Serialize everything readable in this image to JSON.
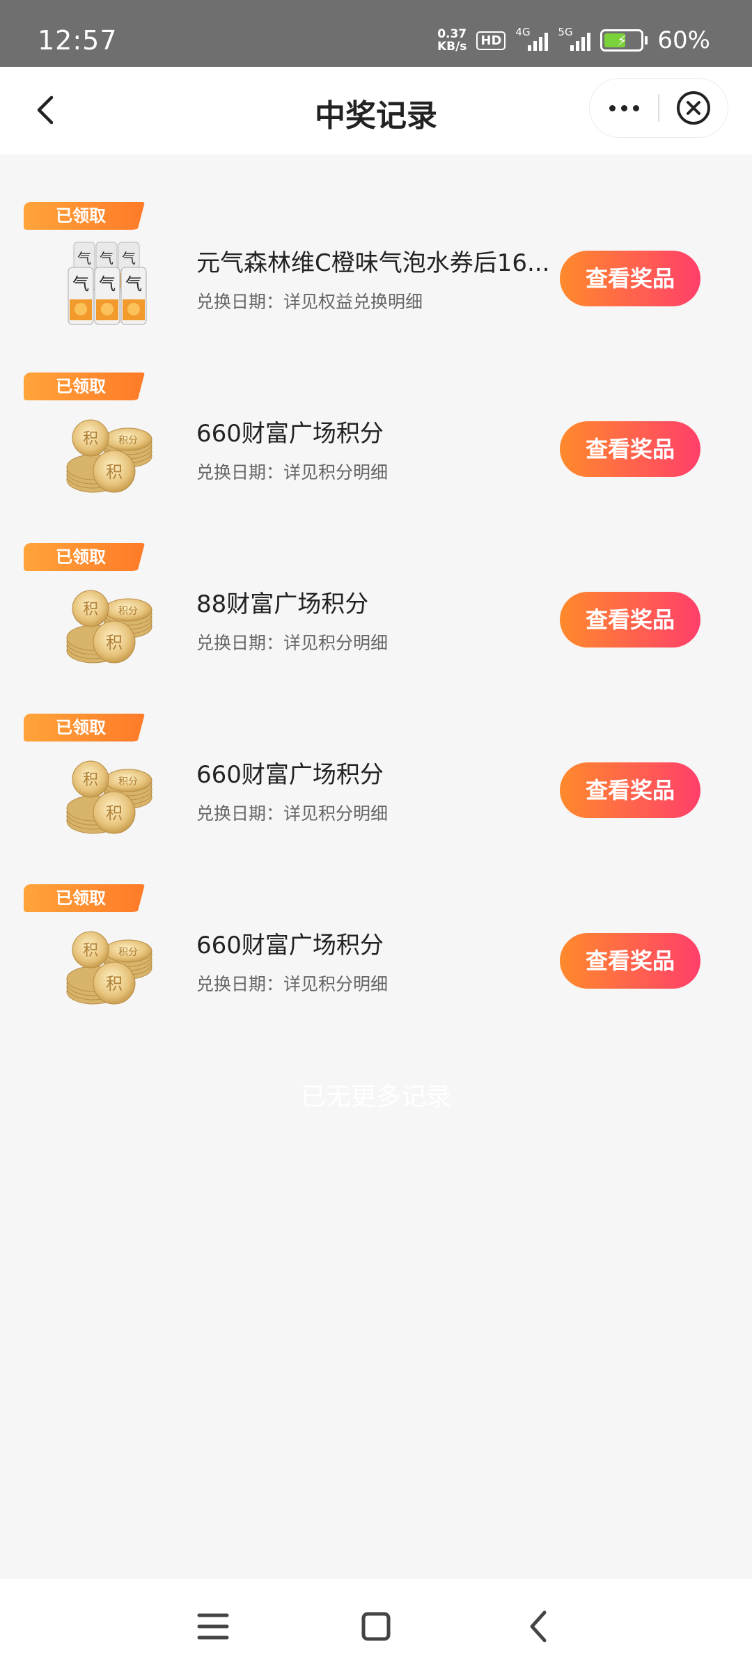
{
  "status_bar": {
    "time": "12:57",
    "net_speed_value": "0.37",
    "net_speed_unit": "KB/s",
    "hd_label": "HD",
    "sim1_label": "4G",
    "sim2_label": "5G",
    "battery_percent": "60%",
    "battery_level": 0.6,
    "battery_color": "#7bd23a"
  },
  "nav": {
    "title": "中奖记录"
  },
  "colors": {
    "tag_gradient": [
      "#ffa43a",
      "#ff7a28"
    ],
    "button_gradient": [
      "#ff8a2c",
      "#ff3f6a"
    ]
  },
  "records": [
    {
      "tag": "已领取",
      "title": "元气森林维C橙味气泡水券后16...",
      "subtitle": "兑换日期：详见权益兑换明细",
      "button": "查看奖品",
      "image": "sparkling-water-cans"
    },
    {
      "tag": "已领取",
      "title": "660财富广场积分",
      "subtitle": "兑换日期：详见积分明细",
      "button": "查看奖品",
      "image": "gold-coins"
    },
    {
      "tag": "已领取",
      "title": "88财富广场积分",
      "subtitle": "兑换日期：详见积分明细",
      "button": "查看奖品",
      "image": "gold-coins"
    },
    {
      "tag": "已领取",
      "title": "660财富广场积分",
      "subtitle": "兑换日期：详见积分明细",
      "button": "查看奖品",
      "image": "gold-coins"
    },
    {
      "tag": "已领取",
      "title": "660财富广场积分",
      "subtitle": "兑换日期：详见积分明细",
      "button": "查看奖品",
      "image": "gold-coins"
    }
  ],
  "footer_text": "已无更多记录"
}
